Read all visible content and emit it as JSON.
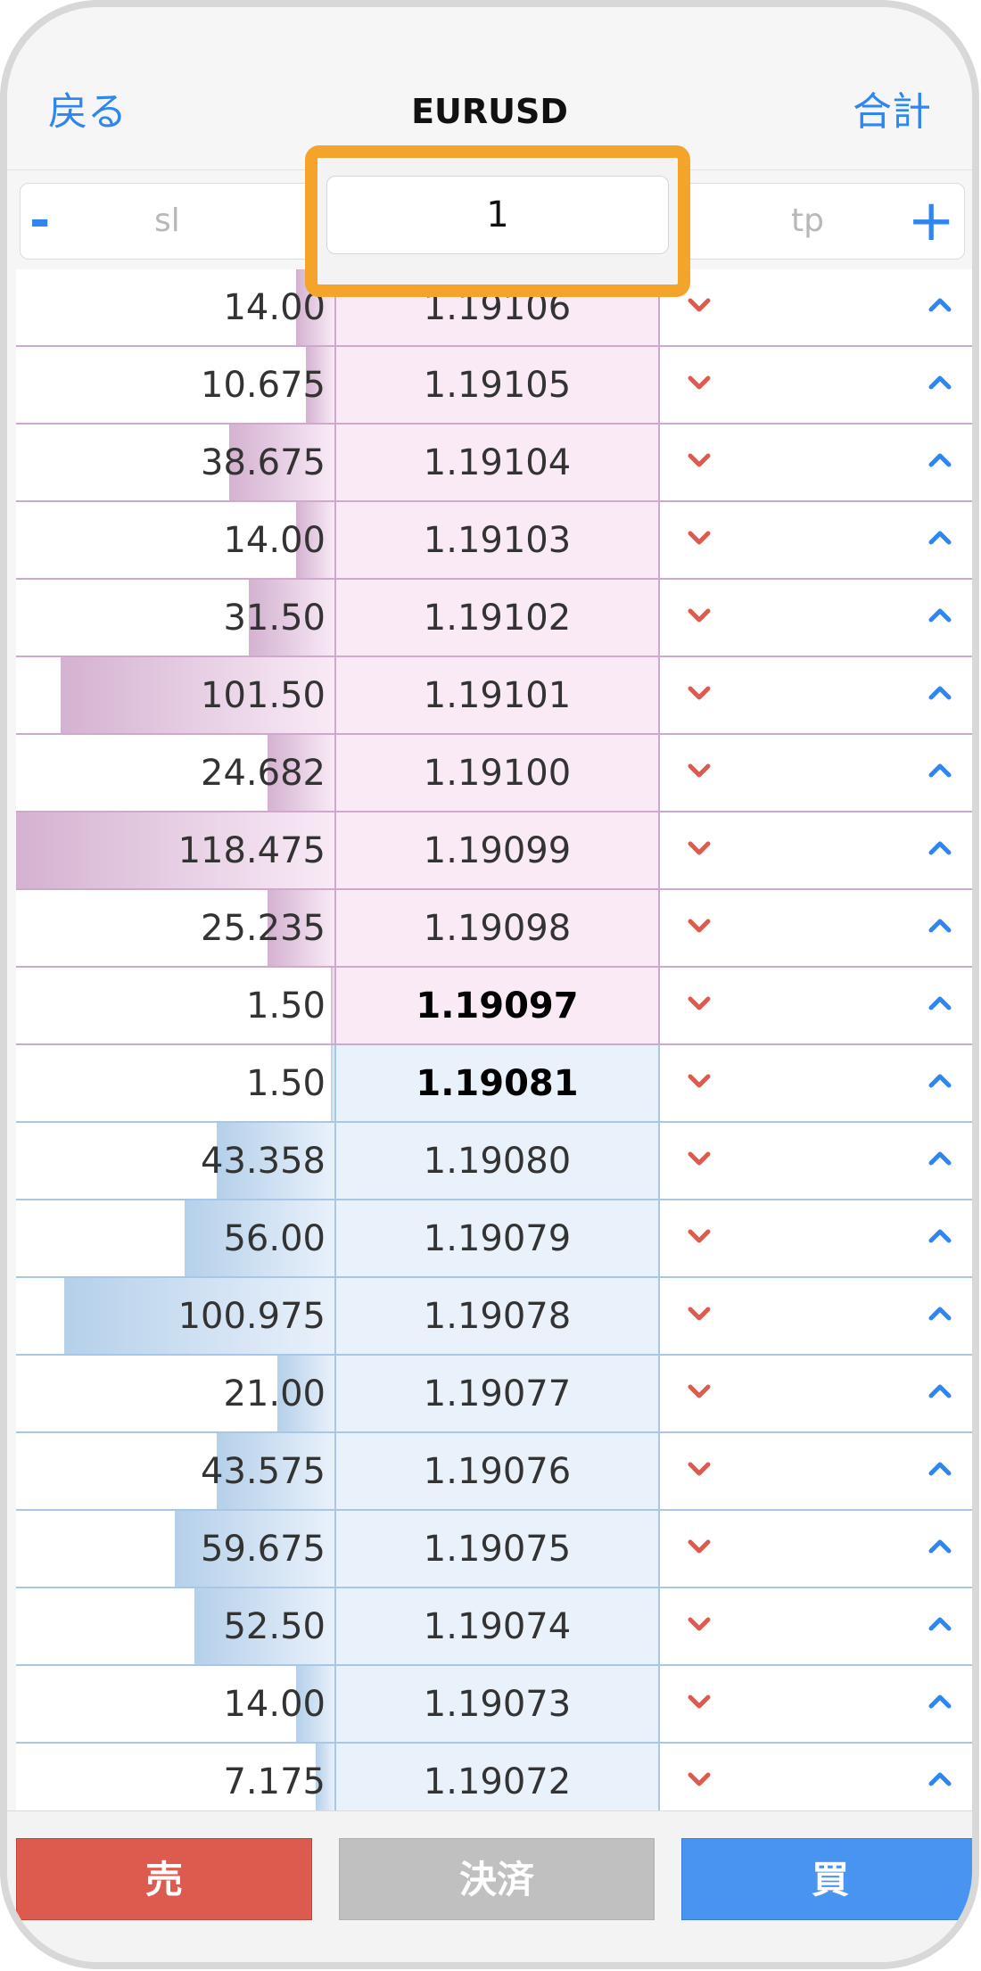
{
  "nav": {
    "back_label": "戻る",
    "title": "EURUSD",
    "total_label": "合計"
  },
  "params": {
    "sl_label": "sl",
    "tp_label": "tp",
    "minus_symbol": "-",
    "plus_symbol": "+",
    "volume_value": "1"
  },
  "colors": {
    "accent": "#2f86f0",
    "highlight": "#f4a42b",
    "sell": "#dd5a4f",
    "buy": "#4a94f1",
    "close": "#c0c0c0"
  },
  "order_book": {
    "asks": [
      {
        "volume": "14.00",
        "price": "1.19106",
        "depth": 0.12
      },
      {
        "volume": "10.675",
        "price": "1.19105",
        "depth": 0.09
      },
      {
        "volume": "38.675",
        "price": "1.19104",
        "depth": 0.33
      },
      {
        "volume": "14.00",
        "price": "1.19103",
        "depth": 0.12
      },
      {
        "volume": "31.50",
        "price": "1.19102",
        "depth": 0.27
      },
      {
        "volume": "101.50",
        "price": "1.19101",
        "depth": 0.86
      },
      {
        "volume": "24.682",
        "price": "1.19100",
        "depth": 0.21
      },
      {
        "volume": "118.475",
        "price": "1.19099",
        "depth": 1.0
      },
      {
        "volume": "25.235",
        "price": "1.19098",
        "depth": 0.21
      },
      {
        "volume": "1.50",
        "price": "1.19097",
        "depth": 0.01,
        "best": true
      }
    ],
    "bids": [
      {
        "volume": "1.50",
        "price": "1.19081",
        "depth": 0.01,
        "best": true
      },
      {
        "volume": "43.358",
        "price": "1.19080",
        "depth": 0.37
      },
      {
        "volume": "56.00",
        "price": "1.19079",
        "depth": 0.47
      },
      {
        "volume": "100.975",
        "price": "1.19078",
        "depth": 0.85
      },
      {
        "volume": "21.00",
        "price": "1.19077",
        "depth": 0.18
      },
      {
        "volume": "43.575",
        "price": "1.19076",
        "depth": 0.37
      },
      {
        "volume": "59.675",
        "price": "1.19075",
        "depth": 0.5
      },
      {
        "volume": "52.50",
        "price": "1.19074",
        "depth": 0.44
      },
      {
        "volume": "14.00",
        "price": "1.19073",
        "depth": 0.12
      },
      {
        "volume": "7.175",
        "price": "1.19072",
        "depth": 0.06
      }
    ],
    "sell_icon": "chevron-down-icon",
    "buy_icon": "chevron-up-icon"
  },
  "actions": {
    "sell_label": "売",
    "close_label": "決済",
    "buy_label": "買"
  }
}
